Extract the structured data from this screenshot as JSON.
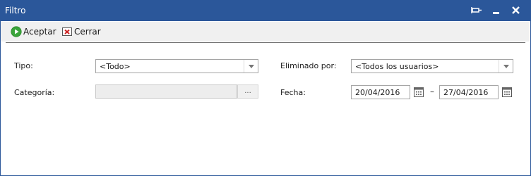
{
  "window": {
    "title": "Filtro"
  },
  "toolbar": {
    "accept_label": "Aceptar",
    "close_label": "Cerrar"
  },
  "form": {
    "tipo_label": "Tipo:",
    "tipo_value": "<Todo>",
    "categoria_label": "Categoría:",
    "categoria_value": "",
    "categoria_browse": "...",
    "eliminado_label": "Eliminado por:",
    "eliminado_value": "<Todos los usuarios>",
    "fecha_label": "Fecha:",
    "fecha_desde": "20/04/2016",
    "fecha_separator": "–",
    "fecha_hasta": "27/04/2016"
  },
  "colors": {
    "titlebar": "#2b579a",
    "accept_icon": "#3aa43a",
    "close_icon": "#cc2222"
  },
  "icons": [
    "pin-icon",
    "minimize-icon",
    "close-window-icon",
    "accept-icon",
    "close-doc-icon",
    "calendar-icon"
  ]
}
